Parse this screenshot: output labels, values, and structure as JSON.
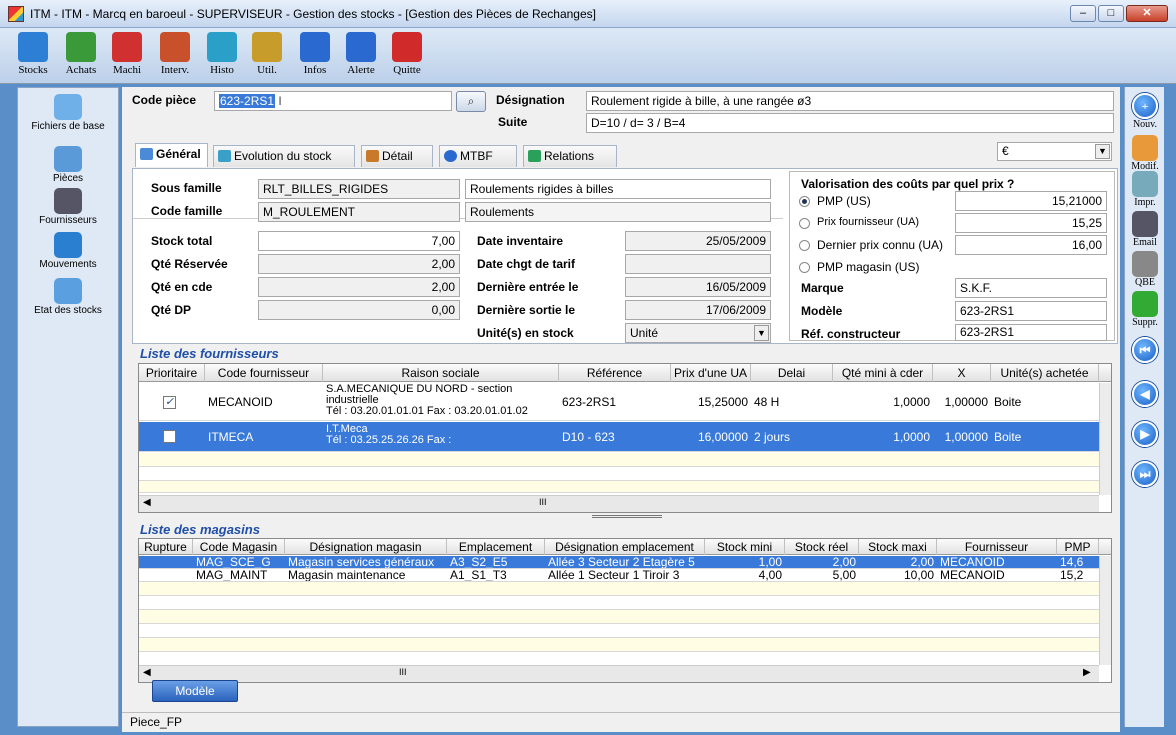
{
  "window": {
    "title": "ITM - ITM -  Marcq en baroeul - SUPERVISEUR -  Gestion des stocks - [Gestion des Pièces de Rechanges]",
    "min": "–",
    "max": "□",
    "close": "✕"
  },
  "toolbar": [
    {
      "label": "Stocks",
      "icon": "gears-icon",
      "color": "#2c7fd4"
    },
    {
      "label": "Achats",
      "icon": "cart-icon",
      "color": "#3a9a3a"
    },
    {
      "label": "Machi",
      "icon": "machine-icon",
      "color": "#d03030"
    },
    {
      "label": "Interv.",
      "icon": "worker-icon",
      "color": "#c8502a"
    },
    {
      "label": "Histo",
      "icon": "chart-icon",
      "color": "#2aa0c8"
    },
    {
      "label": "Util.",
      "icon": "tools-icon",
      "color": "#c89c2a"
    },
    {
      "label": "Infos",
      "icon": "help-icon",
      "color": "#2a6ad0"
    },
    {
      "label": "Alerte",
      "icon": "info-icon",
      "color": "#2a6ad0"
    },
    {
      "label": "Quitte",
      "icon": "quit-icon",
      "color": "#d02a2a"
    }
  ],
  "leftnav": [
    {
      "label": "Fichiers de base",
      "icon": "files-icon"
    },
    {
      "label": "Pièces",
      "icon": "gears-icon"
    },
    {
      "label": "Fournisseurs",
      "icon": "truck-icon"
    },
    {
      "label": "Mouvements",
      "icon": "movement-icon"
    },
    {
      "label": "Etat des stocks",
      "icon": "globe-icon"
    }
  ],
  "rightnav": [
    {
      "label": "Nouv.",
      "glyph": "+"
    },
    {
      "label": "Modif.",
      "glyph": ""
    },
    {
      "label": "Impr.",
      "glyph": ""
    },
    {
      "label": "Email",
      "glyph": ""
    },
    {
      "label": "QBE",
      "glyph": ""
    },
    {
      "label": "Suppr.",
      "glyph": ""
    },
    {
      "label": "",
      "glyph": "⏮"
    },
    {
      "label": "",
      "glyph": "◀"
    },
    {
      "label": "",
      "glyph": "▶"
    },
    {
      "label": "",
      "glyph": "⏭"
    }
  ],
  "header": {
    "code_label": "Code pièce",
    "code_value": "623-2RS1",
    "designation_label": "Désignation",
    "designation_value": "Roulement rigide à bille, à une rangée ø3",
    "suite_label": "Suite",
    "suite_value": "D=10 / d= 3 / B=4"
  },
  "tabs": [
    "Général",
    "Evolution du stock",
    "Détail",
    "MTBF",
    "Relations"
  ],
  "currency": "€",
  "general": {
    "sous_famille_label": "Sous famille",
    "sous_famille_code": "RLT_BILLES_RIGIDES",
    "sous_famille_lib": "Roulements rigides à billes",
    "code_famille_label": "Code famille",
    "code_famille_code": "M_ROULEMENT",
    "code_famille_lib": "Roulements",
    "stock_total_label": "Stock total",
    "stock_total": "7,00",
    "qte_res_label": "Qté Réservée",
    "qte_res": "2,00",
    "qte_cde_label": "Qté en cde",
    "qte_cde": "2,00",
    "qte_dp_label": "Qté DP",
    "qte_dp": "0,00",
    "date_inv_label": "Date inventaire",
    "date_inv": "25/05/2009",
    "date_tarif_label": "Date chgt de tarif",
    "date_tarif": "",
    "der_entree_label": "Dernière entrée le",
    "der_entree": "16/05/2009",
    "der_sortie_label": "Dernière sortie le",
    "der_sortie": "17/06/2009",
    "unite_label": "Unité(s) en stock",
    "unite": "Unité"
  },
  "valorisation": {
    "title": "Valorisation des coûts par quel prix ?",
    "pmp_label": "PMP (US)",
    "pmp": "15,21000",
    "prix_f_label": "Prix fournisseur (UA)",
    "prix_f": "15,25",
    "dernier_label": "Dernier prix connu (UA)",
    "dernier": "16,00",
    "pmp_mag_label": "PMP magasin (US)",
    "marque_label": "Marque",
    "marque": "S.K.F.",
    "modele_label": "Modèle",
    "modele": "623-2RS1",
    "ref_label": "Réf. constructeur",
    "ref": "623-2RS1"
  },
  "fournisseurs": {
    "title": "Liste des fournisseurs",
    "columns": [
      "Prioritaire",
      "Code fournisseur",
      "Raison sociale",
      "Référence",
      "Prix d'une UA",
      "Delai",
      "Qté mini à cder",
      "X",
      "Unité(s) achetée"
    ],
    "rows": [
      {
        "prio": "✓",
        "code": "MECANOID",
        "raison1": "S.A.MECANIQUE DU NORD - section industrielle",
        "raison2": "Tél : 03.20.01.01.01  Fax : 03.20.01.01.02",
        "ref": "623-2RS1",
        "prix": "15,25000",
        "delai": "48 H",
        "qte": "1,0000",
        "x": "1,00000",
        "unite": "Boite"
      },
      {
        "prio": "",
        "code": "ITMECA",
        "raison1": "I.T.Meca",
        "raison2": "Tél : 03.25.25.26.26  Fax :",
        "ref": "D10 - 623",
        "prix": "16,00000",
        "delai": "2 jours",
        "qte": "1,0000",
        "x": "1,00000",
        "unite": "Boite"
      }
    ],
    "hscroll": "III"
  },
  "magasins": {
    "title": "Liste des magasins",
    "columns": [
      "Rupture",
      "Code Magasin",
      "Désignation magasin",
      "Emplacement",
      "Désignation emplacement",
      "Stock mini",
      "Stock réel",
      "Stock maxi",
      "Fournisseur",
      "PMP"
    ],
    "rows": [
      {
        "code": "MAG_SCE_G",
        "desig": "Magasin services généraux",
        "empl": "A3_S2_E5",
        "desig_empl": "Allée 3  Secteur 2  Etagère 5",
        "mini": "1,00",
        "reel": "2,00",
        "maxi": "2,00",
        "fourn": "MECANOID",
        "pmp": "14,6"
      },
      {
        "code": "MAG_MAINT",
        "desig": "Magasin maintenance",
        "empl": "A1_S1_T3",
        "desig_empl": "Allée 1  Secteur 1  Tiroir 3",
        "mini": "4,00",
        "reel": "5,00",
        "maxi": "10,00",
        "fourn": "MECANOID",
        "pmp": "15,2"
      }
    ],
    "hscroll": "III"
  },
  "modele_button": "Modèle",
  "status": "Piece_FP"
}
